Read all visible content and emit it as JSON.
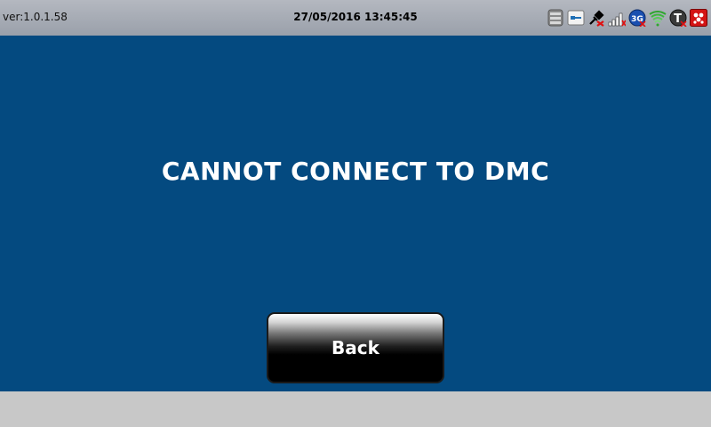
{
  "status_bar": {
    "version": "ver:1.0.1.58",
    "datetime": "27/05/2016 13:45:45",
    "icons": [
      "storage-icon",
      "usb-icon",
      "network-disconnected-icon",
      "signal-bars-icon",
      "3g-icon",
      "wifi-icon",
      "t-status-icon",
      "app-status-icon"
    ],
    "icon_3g_label": "3G",
    "icon_t_label": "T"
  },
  "main": {
    "message": "CANNOT CONNECT TO DMC",
    "back_label": "Back",
    "background": "#044a80"
  }
}
